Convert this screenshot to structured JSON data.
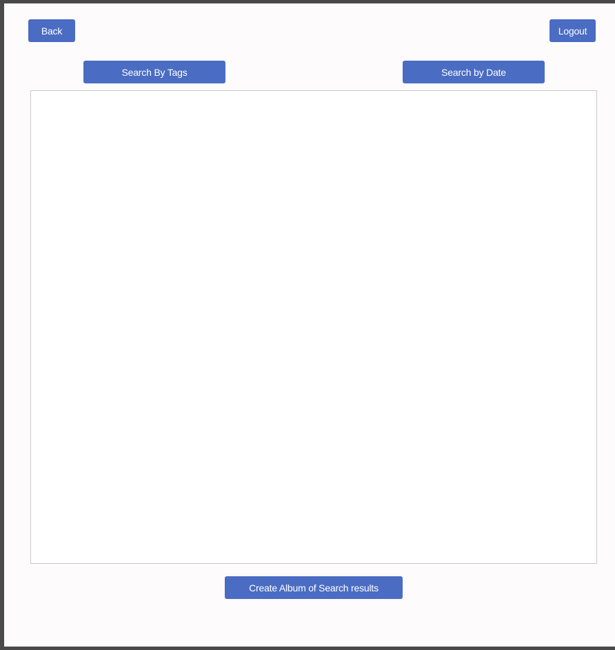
{
  "toolbar": {
    "back_label": "Back",
    "logout_label": "Logout"
  },
  "search": {
    "by_tags_label": "Search By Tags",
    "by_date_label": "Search by Date"
  },
  "results": {
    "items": []
  },
  "actions": {
    "create_album_label": "Create Album of Search results"
  },
  "colors": {
    "button_bg": "#4a6cc3",
    "button_text": "#ffffff",
    "window_bg": "#fdfbfc",
    "list_border": "#c9c9c9"
  }
}
